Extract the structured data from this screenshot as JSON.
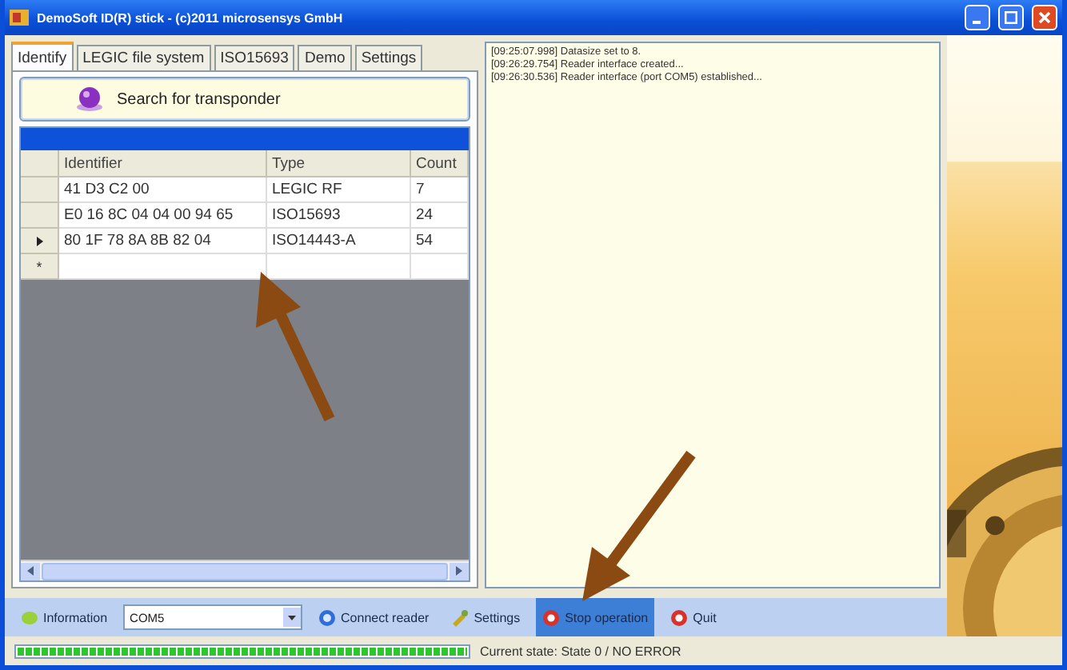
{
  "window": {
    "title": "DemoSoft ID(R) stick - (c)2011 microsensys GmbH"
  },
  "tabs": [
    {
      "label": "Identify",
      "selected": true
    },
    {
      "label": "LEGIC file system",
      "selected": false
    },
    {
      "label": "ISO15693",
      "selected": false
    },
    {
      "label": "Demo",
      "selected": false
    },
    {
      "label": "Settings",
      "selected": false
    }
  ],
  "search_button": {
    "label": "Search for transponder"
  },
  "table": {
    "columns": [
      "Identifier",
      "Type",
      "Count"
    ],
    "rows": [
      {
        "cells": [
          "41 D3 C2 00",
          "LEGIC RF",
          "7"
        ],
        "current": false
      },
      {
        "cells": [
          "E0 16 8C 04 04 00 94 65",
          "ISO15693",
          "24"
        ],
        "current": false
      },
      {
        "cells": [
          "80 1F 78 8A 8B 82 04",
          "ISO14443-A",
          "54"
        ],
        "current": true
      }
    ],
    "new_row_marker": "*"
  },
  "log": [
    "[09:25:07.998] Datasize set to 8.",
    "[09:26:29.754] Reader interface created...",
    "[09:26:30.536] Reader interface (port COM5) established..."
  ],
  "toolbar": {
    "items": [
      {
        "kind": "button",
        "label": "Information",
        "selected": false
      },
      {
        "kind": "combo",
        "value": "COM5"
      },
      {
        "kind": "button",
        "label": "Connect reader",
        "selected": false
      },
      {
        "kind": "button",
        "label": "Settings",
        "selected": false
      },
      {
        "kind": "button",
        "label": "Stop operation",
        "selected": true
      },
      {
        "kind": "button",
        "label": "Quit",
        "selected": false
      }
    ]
  },
  "status_bar": {
    "progress": {
      "level": 1
    },
    "text": "Current state: State 0 / NO ERROR"
  }
}
